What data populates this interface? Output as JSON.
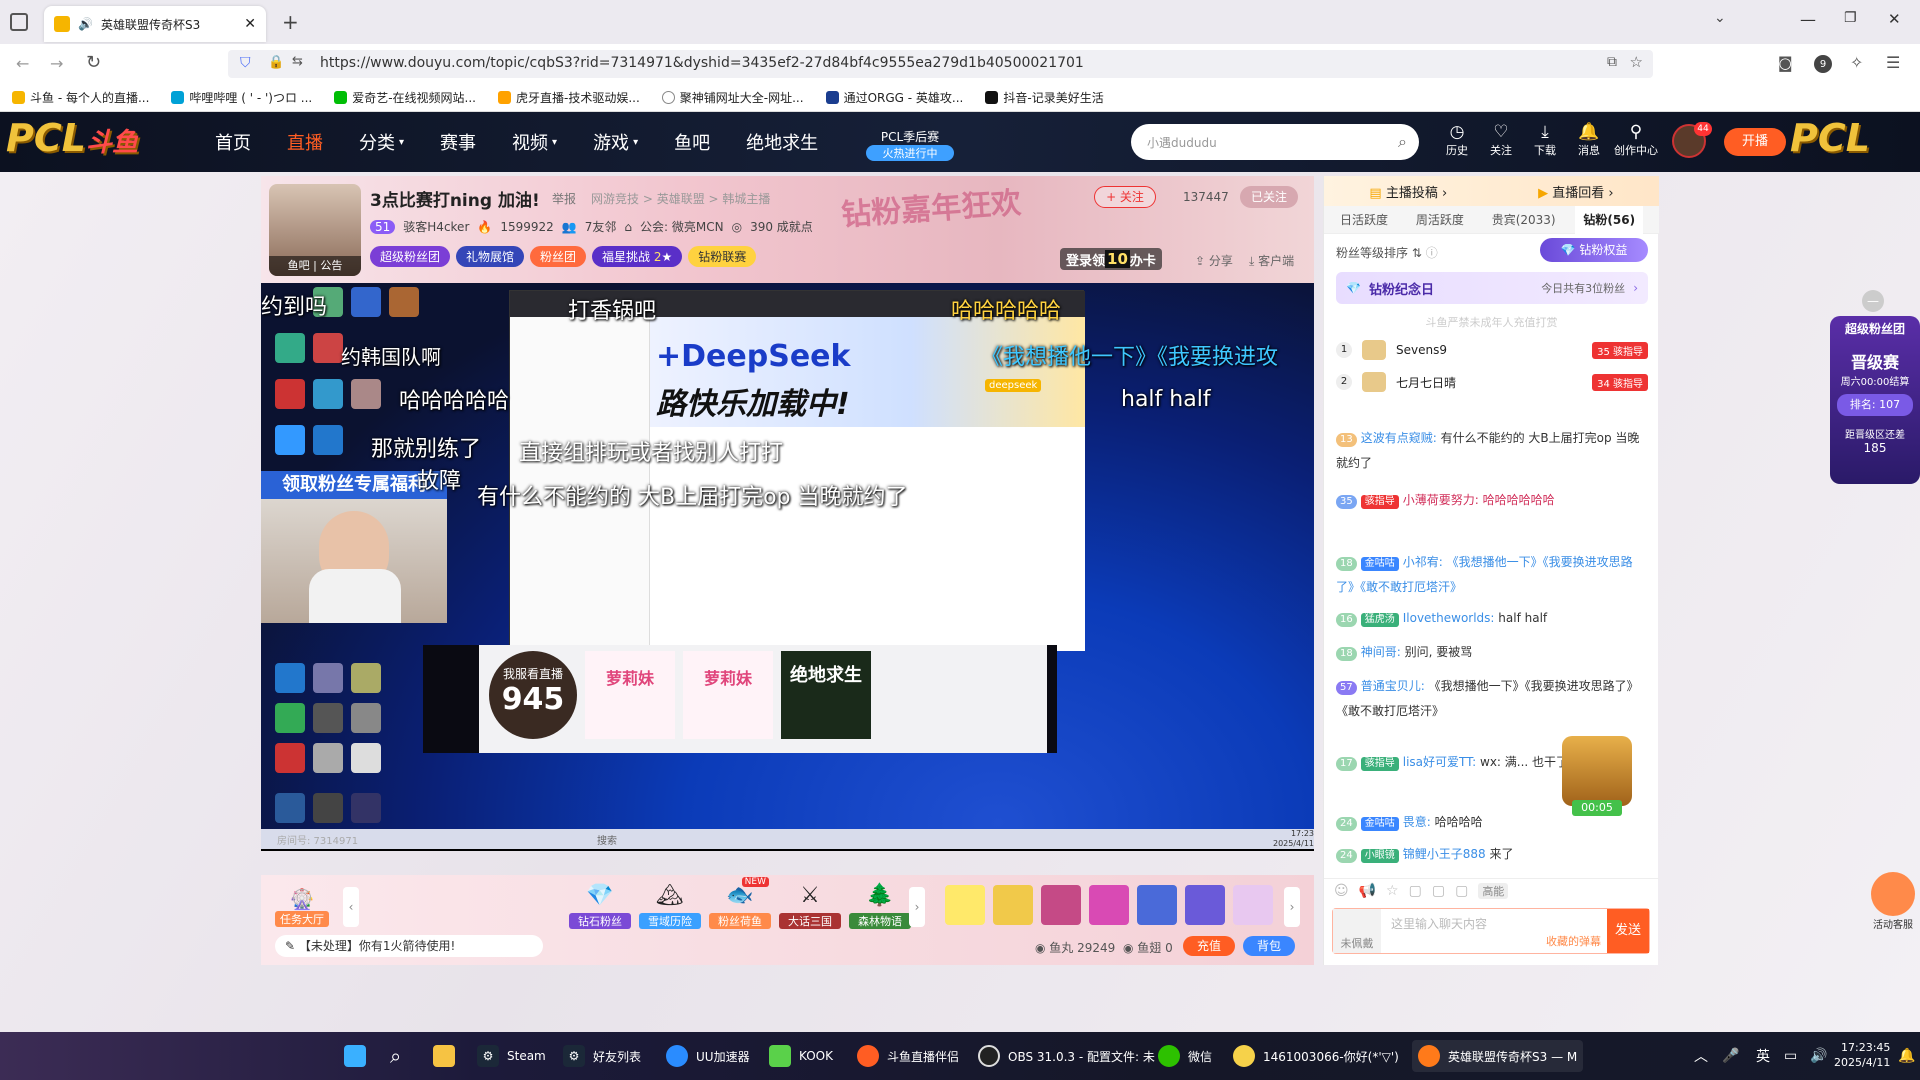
{
  "browser": {
    "tab_title": "英雄联盟传奇杯S3",
    "url": "https://www.douyu.com/topic/cqbS3?rid=7314971&dyshid=3435ef2-27d84bf4c9555ea279d1b40500021701",
    "bookmarks": [
      "斗鱼 - 每个人的直播...",
      "哔哩哔哩 ( ' - ')つロ ...",
      "爱奇艺-在线视频网站...",
      "虎牙直播-技术驱动娱...",
      "聚神铺网址大全-网址...",
      "通过ORGG - 英雄攻...",
      "抖音-记录美好生活"
    ],
    "badge_count": "9"
  },
  "site": {
    "logo": "PCL",
    "menu": [
      "首页",
      "直播",
      "分类",
      "赛事",
      "视频",
      "游戏",
      "鱼吧",
      "绝地求生"
    ],
    "promo_line1": "PCL季后赛",
    "promo_line2": "火热进行中",
    "search_placeholder": "小遇dududu",
    "header_icons": [
      "历史",
      "关注",
      "下载",
      "消息",
      "创作中心"
    ],
    "avatar_badge": "44",
    "open_label": "开播"
  },
  "room": {
    "title": "3点比赛打ning 加油!",
    "report": "举报",
    "tags": [
      "网游竞技",
      "英雄联盟",
      "韩城主播"
    ],
    "follow": "+ 关注",
    "hot": "137447",
    "followed": "已关注",
    "level": "51",
    "host": "骇客H4cker",
    "fans": "1599922",
    "friends": "7友邻",
    "guild": "公会: 微亮MCN",
    "achievements": "390 成就点",
    "avatar_labels": [
      "鱼吧",
      "公告"
    ],
    "chips": [
      "超级粉丝团",
      "礼物展馆",
      "粉丝团",
      "福星挑战",
      "2",
      "钻粉联赛"
    ],
    "login_card": "登录领",
    "login_card_num": "10",
    "login_card_suffix": "办卡",
    "share": "分享",
    "client": "客户端",
    "banner_text": "钻粉嘉年狂欢"
  },
  "video": {
    "overlay_banner": "领取粉丝专属福利",
    "danmu": [
      "约到吗",
      "打香锅吧",
      "约韩国队啊",
      "哈哈哈哈哈",
      "哈哈哈哈哈",
      "《我想播他一下》《我要换进攻",
      "half half",
      "那就别练了",
      "直接组排玩或者找别人打打",
      "有什么不能约的 大B上届打完op 当晚就约了",
      "故障"
    ],
    "ad_title": "+DeepSeek",
    "ad_sub": "路快乐加载中!",
    "ad_tag": "deepseek",
    "tiles": [
      "945",
      "萝莉妹",
      "萝莉妹",
      "绝地求生"
    ],
    "tile_top": "我服看直播",
    "room_id_label": "房间号: 7314971",
    "win_time": "17:23",
    "win_date": "2025/4/11",
    "search_label": "搜索"
  },
  "gifts": {
    "task_hall": "任务大厅",
    "items": [
      "钻石粉丝",
      "雪域历险",
      "粉丝荷鱼",
      "大话三国",
      "森林物语"
    ],
    "new_tag": "NEW",
    "notice": "【未处理】你有1火箭待使用!",
    "fish_ball_label": "鱼丸",
    "fish_ball": "29249",
    "fish_fin_label": "鱼翅",
    "fish_fin": "0",
    "recharge": "充值",
    "backpack": "背包"
  },
  "right": {
    "top_links": [
      "主播投稿",
      "直播回看"
    ],
    "tabs": [
      "日活跃度",
      "周活跃度",
      "贵宾(2033)",
      "钻粉(56)"
    ],
    "sort_label": "粉丝等级排序",
    "diamond_rights": "钻粉权益",
    "anniv_title": "钻粉纪念日",
    "anniv_right": "今日共有3位粉丝",
    "notice": "斗鱼严禁未成年人充值打赏",
    "ranks": [
      {
        "rank": "1",
        "name": "Sevens9",
        "level": "35",
        "badge": "骇指导"
      },
      {
        "rank": "2",
        "name": "七月七日晴",
        "level": "34",
        "badge": "骇指导"
      }
    ],
    "messages": [
      {
        "lv": "13",
        "badge": "",
        "user": "这波有点窥贼:",
        "text": "有什么不能约的 大B上届打完op 当晚就约了"
      },
      {
        "lv": "35",
        "badge": "骇指导",
        "user": "小薄荷要努力:",
        "text": "哈哈哈哈哈哈"
      },
      {
        "lv": "18",
        "badge": "金咕咕",
        "user": "小祁宥:",
        "text": "《我想播他一下》《我要换进攻思路了》《敢不敢打厄塔汗》"
      },
      {
        "lv": "16",
        "badge": "猛虎汤",
        "user": "Ilovetheworlds:",
        "text": "half half"
      },
      {
        "lv": "18",
        "badge": "",
        "user": "神间哥:",
        "text": "别问, 要被骂"
      },
      {
        "lv": "57",
        "badge": "",
        "user": "普通宝贝儿:",
        "text": "《我想播他一下》《我要换进攻思路了》《敢不敢打厄塔汗》"
      },
      {
        "lv": "17",
        "badge": "骇指导",
        "user": "lisa好可爱TT:",
        "text": "wx: 满... 也干了"
      },
      {
        "lv": "24",
        "badge": "金咕咕",
        "user": "畏意:",
        "text": "哈哈哈哈"
      },
      {
        "lv": "24",
        "badge": "小眼镜",
        "user": "锦鲤小王子888",
        "text": "来了"
      }
    ],
    "chest_timer": "00:05",
    "chat_placeholder": "这里输入聊天内容",
    "barrage": "收藏的弹幕",
    "send": "发送",
    "not_wearing": "未佩戴",
    "tool_label": "高能"
  },
  "float_badge": {
    "title": "超级粉丝团",
    "line1": "晋级赛",
    "line2": "周六00:00结算",
    "rank": "排名: 107",
    "dist_label": "距晋级区还差",
    "dist": "185"
  },
  "service": "活动客服",
  "taskbar": {
    "apps": [
      "Steam",
      "好友列表",
      "UU加速器",
      "KOOK",
      "斗鱼直播伴侣",
      "OBS 31.0.3 - 配置文件: 未",
      "微信",
      "1461003066-你好(*'▽')",
      "英雄联盟传奇杯S3 — M"
    ],
    "ime": "英",
    "time": "17:23:45",
    "date": "2025/4/11"
  }
}
